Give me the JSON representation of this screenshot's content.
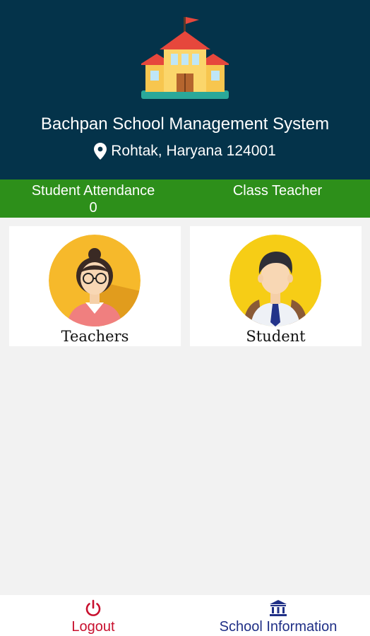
{
  "header": {
    "title": "Bachpan School Management System",
    "address": "Rohtak, Haryana 124001",
    "logo_icon": "school-building-icon",
    "location_icon": "map-pin-icon",
    "background_color": "#04334a"
  },
  "stats": {
    "attendance_label": "Student Attendance",
    "attendance_value": "0",
    "class_teacher_label": "Class Teacher",
    "bar_color": "#2d8f1a"
  },
  "cards": {
    "teachers": {
      "label": "Teachers",
      "icon": "teacher-avatar-icon"
    },
    "student": {
      "label": "Student",
      "icon": "student-avatar-icon"
    }
  },
  "bottom_nav": {
    "logout": {
      "label": "Logout",
      "icon": "power-icon",
      "color": "#c8102e"
    },
    "school_info": {
      "label": "School Information",
      "icon": "bank-building-icon",
      "color": "#1f2f86"
    }
  }
}
